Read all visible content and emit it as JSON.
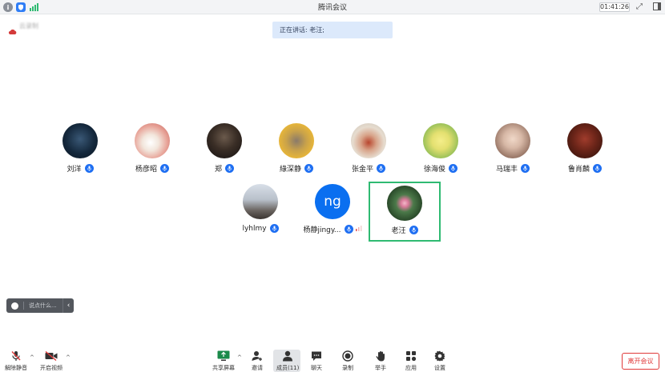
{
  "window": {
    "title": "腾讯会议",
    "timer": "01:41:26"
  },
  "speaking": {
    "text": "正在讲话: 老汪;"
  },
  "participants": [
    {
      "name": "刘洋",
      "avatar": "photo-dark-blue",
      "mic": "mic-icon"
    },
    {
      "name": "杨彦昭",
      "avatar": "photo-anime",
      "mic": "mic-icon"
    },
    {
      "name": "郑",
      "avatar": "photo-dark",
      "mic": "mic-icon"
    },
    {
      "name": "綠深静",
      "avatar": "photo-yellow",
      "mic": "mic-icon"
    },
    {
      "name": "张金平",
      "avatar": "photo-tea",
      "mic": "mic-icon"
    },
    {
      "name": "徐海俊",
      "avatar": "photo-flowers",
      "mic": "mic-icon"
    },
    {
      "name": "马瑞丰",
      "avatar": "photo-room",
      "mic": "mic-icon"
    },
    {
      "name": "鲁肖麟",
      "avatar": "photo-darkred",
      "mic": "mic-icon"
    },
    {
      "name": "lyhlmy",
      "avatar": "photo-trees",
      "mic": "mic-icon"
    },
    {
      "name": "杨静jingy...",
      "avatar_text": "ng",
      "mic": "mic-icon",
      "volume_indicator": true
    },
    {
      "name": "老汪",
      "avatar": "photo-lotus",
      "mic": "mic-icon",
      "active_speaker": true
    }
  ],
  "chat": {
    "placeholder": "说点什么...",
    "emoji_icon": "smile-icon",
    "collapse_icon": "chevron-left-icon"
  },
  "toolbar": {
    "left": [
      {
        "label": "解除静音",
        "icon": "mic-muted-icon"
      },
      {
        "label": "开启视频",
        "icon": "video-off-icon"
      }
    ],
    "center": [
      {
        "label": "共享屏幕",
        "icon": "share-screen-icon"
      },
      {
        "label": "邀请",
        "icon": "invite-icon"
      },
      {
        "label": "成员(11)",
        "icon": "members-icon"
      },
      {
        "label": "聊天",
        "icon": "chat-icon"
      },
      {
        "label": "录制",
        "icon": "record-icon"
      },
      {
        "label": "举手",
        "icon": "raise-hand-icon"
      },
      {
        "label": "应用",
        "icon": "apps-icon"
      },
      {
        "label": "设置",
        "icon": "settings-icon"
      }
    ],
    "leave": "离开会议"
  },
  "colors": {
    "accent": "#1f6ff2",
    "active_border": "#2fba72",
    "leave": "#e03a3a",
    "speaking_bg": "#dce9fb"
  }
}
